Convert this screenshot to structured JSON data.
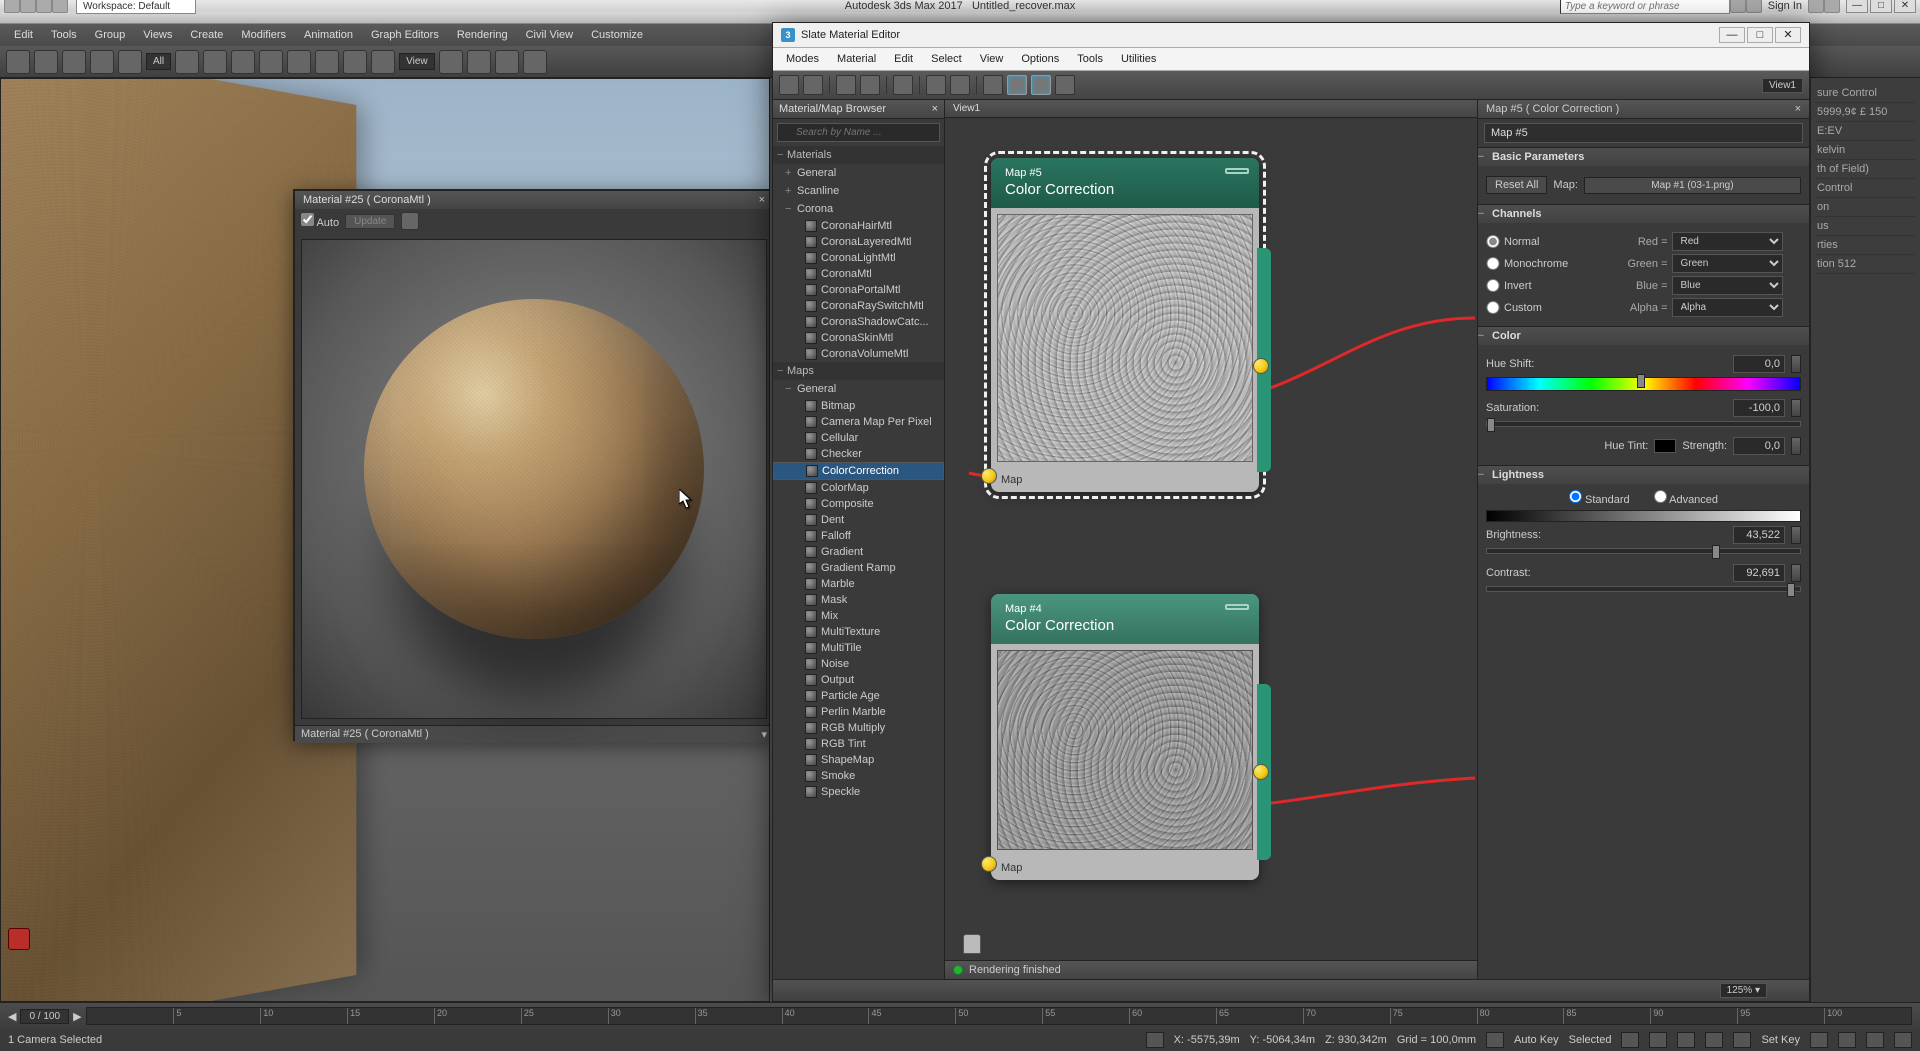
{
  "app": {
    "title": "Autodesk 3ds Max 2017",
    "file": "Untitled_recover.max",
    "workspace_label": "Workspace: Default",
    "keyword_placeholder": "Type a keyword or phrase",
    "signin": "Sign In"
  },
  "menu": [
    "Edit",
    "Tools",
    "Group",
    "Views",
    "Create",
    "Modifiers",
    "Animation",
    "Graph Editors",
    "Rendering",
    "Civil View",
    "Customize"
  ],
  "toolbar": {
    "filter": "All",
    "view": "View"
  },
  "mat_preview": {
    "title": "Material #25  ( CoronaMtl )",
    "auto": "Auto",
    "update": "Update",
    "footer": "Material #25  ( CoronaMtl )"
  },
  "slate": {
    "title": "Slate Material Editor",
    "menu": [
      "Modes",
      "Material",
      "Edit",
      "Select",
      "View",
      "Options",
      "Tools",
      "Utilities"
    ],
    "browser": {
      "title": "Material/Map Browser",
      "search_placeholder": "Search by Name ...",
      "cats": {
        "materials": "Materials",
        "maps": "Maps",
        "general": "General",
        "scanline": "Scanline",
        "corona": "Corona"
      },
      "corona_items": [
        "CoronaHairMtl",
        "CoronaLayeredMtl",
        "CoronaLightMtl",
        "CoronaMtl",
        "CoronaPortalMtl",
        "CoronaRaySwitchMtl",
        "CoronaShadowCatc...",
        "CoronaSkinMtl",
        "CoronaVolumeMtl"
      ],
      "map_items": [
        "Bitmap",
        "Camera Map Per Pixel",
        "Cellular",
        "Checker",
        "ColorCorrection",
        "ColorMap",
        "Composite",
        "Dent",
        "Falloff",
        "Gradient",
        "Gradient Ramp",
        "Marble",
        "Mask",
        "Mix",
        "MultiTexture",
        "MultiTile",
        "Noise",
        "Output",
        "Particle Age",
        "Perlin Marble",
        "RGB Multiply",
        "RGB Tint",
        "ShapeMap",
        "Smoke",
        "Speckle"
      ],
      "selected": "ColorCorrection"
    },
    "graph": {
      "tab": "View1",
      "node5": {
        "title": "Map #5",
        "sub": "Color Correction",
        "sock": "Map"
      },
      "node4": {
        "title": "Map #4",
        "sub": "Color Correction",
        "sock": "Map"
      }
    },
    "status": "Rendering finished",
    "zoom": "125%  ▾"
  },
  "params": {
    "title": "Map #5  ( Color Correction )",
    "mapname": "Map #5",
    "basic": {
      "hdr": "Basic Parameters",
      "reset": "Reset All",
      "map_lbl": "Map:",
      "map_btn": "Map #1 (03-1.png)"
    },
    "channels": {
      "hdr": "Channels",
      "modes": {
        "normal": "Normal",
        "mono": "Monochrome",
        "invert": "Invert",
        "custom": "Custom"
      },
      "lbl": {
        "red": "Red =",
        "green": "Green =",
        "blue": "Blue =",
        "alpha": "Alpha ="
      },
      "val": {
        "red": "Red",
        "green": "Green",
        "blue": "Blue",
        "alpha": "Alpha"
      }
    },
    "color": {
      "hdr": "Color",
      "hue_lbl": "Hue Shift:",
      "hue_val": "0,0",
      "sat_lbl": "Saturation:",
      "sat_val": "-100,0",
      "tint_lbl": "Hue Tint:",
      "str_lbl": "Strength:",
      "str_val": "0,0"
    },
    "light": {
      "hdr": "Lightness",
      "std": "Standard",
      "adv": "Advanced",
      "bri_lbl": "Brightness:",
      "bri_val": "43,522",
      "con_lbl": "Contrast:",
      "con_val": "92,691"
    }
  },
  "cmd_sliver": [
    "sure Control",
    "5999,9¢ £ 150",
    "E:EV",
    "kelvin",
    "th of Field)",
    "Control",
    "on",
    "us",
    "rties",
    "tion  512"
  ],
  "timeline": {
    "frame": "0 / 100",
    "ticks": [
      "5",
      "10",
      "15",
      "20",
      "25",
      "30",
      "35",
      "40",
      "45",
      "50",
      "55",
      "60",
      "65",
      "70",
      "75",
      "80",
      "85",
      "90",
      "95",
      "100"
    ]
  },
  "statusbar": {
    "sel": "1 Camera Selected",
    "x": "X: -5575,39m",
    "y": "Y: -5064,34m",
    "z": "Z: 930,342m",
    "grid": "Grid = 100,0mm",
    "autokey": "Auto Key",
    "selected": "Selected",
    "setkey": "Set Key",
    "view_tab": "View1"
  }
}
